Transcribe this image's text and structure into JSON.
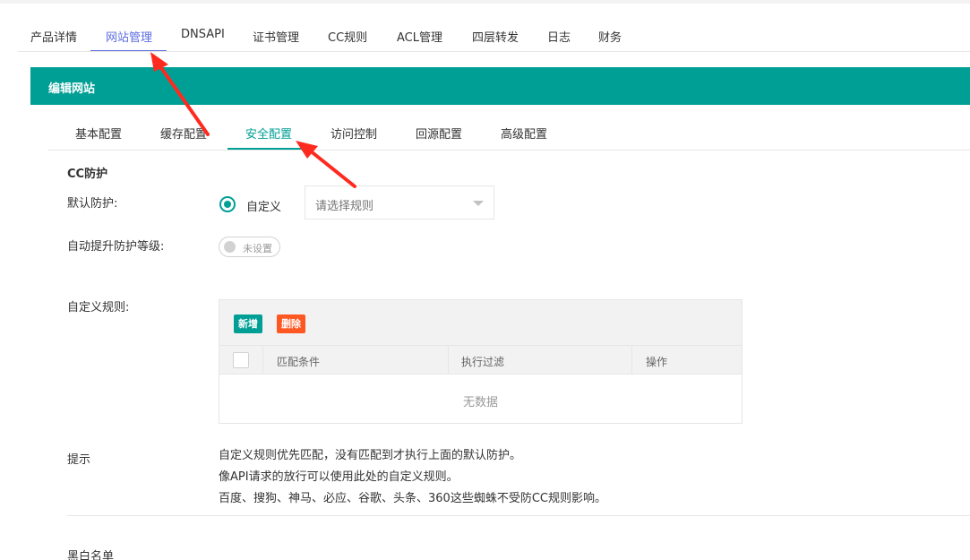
{
  "top_nav": {
    "tabs": [
      {
        "label": "产品详情"
      },
      {
        "label": "网站管理"
      },
      {
        "label": "DNSAPI"
      },
      {
        "label": "证书管理"
      },
      {
        "label": "CC规则"
      },
      {
        "label": "ACL管理"
      },
      {
        "label": "四层转发"
      },
      {
        "label": "日志"
      },
      {
        "label": "财务"
      }
    ],
    "active_index": 1
  },
  "card": {
    "title": "编辑网站"
  },
  "sub_nav": {
    "tabs": [
      {
        "label": "基本配置"
      },
      {
        "label": "缓存配置"
      },
      {
        "label": "安全配置"
      },
      {
        "label": "访问控制"
      },
      {
        "label": "回源配置"
      },
      {
        "label": "高级配置"
      }
    ],
    "active_index": 2
  },
  "cc_section": {
    "title": "CC防护",
    "default_protection": {
      "label": "默认防护:",
      "radio_label": "自定义",
      "radio_checked": true,
      "select_placeholder": "请选择规则"
    },
    "auto_level": {
      "label": "自动提升防护等级:",
      "switch_text": "未设置",
      "switch_on": false
    },
    "custom_rules": {
      "label": "自定义规则:",
      "add_button": "新增",
      "delete_button": "删除",
      "columns": [
        "匹配条件",
        "执行过滤",
        "操作"
      ],
      "rows": [],
      "empty_text": "无数据"
    },
    "tips": {
      "label": "提示",
      "lines": [
        "自定义规则优先匹配，没有匹配到才执行上面的默认防护。",
        "像API请求的放行可以使用此处的自定义规则。",
        "百度、搜狗、神马、必应、谷歌、头条、360这些蜘蛛不受防CC规则影响。"
      ]
    }
  },
  "blackwhite_section": {
    "title": "黑白名单"
  },
  "colors": {
    "primary": "#009f95",
    "nav_active": "#5b6de0",
    "danger": "#ff5722",
    "annotation_arrow": "#ff2a1f"
  }
}
